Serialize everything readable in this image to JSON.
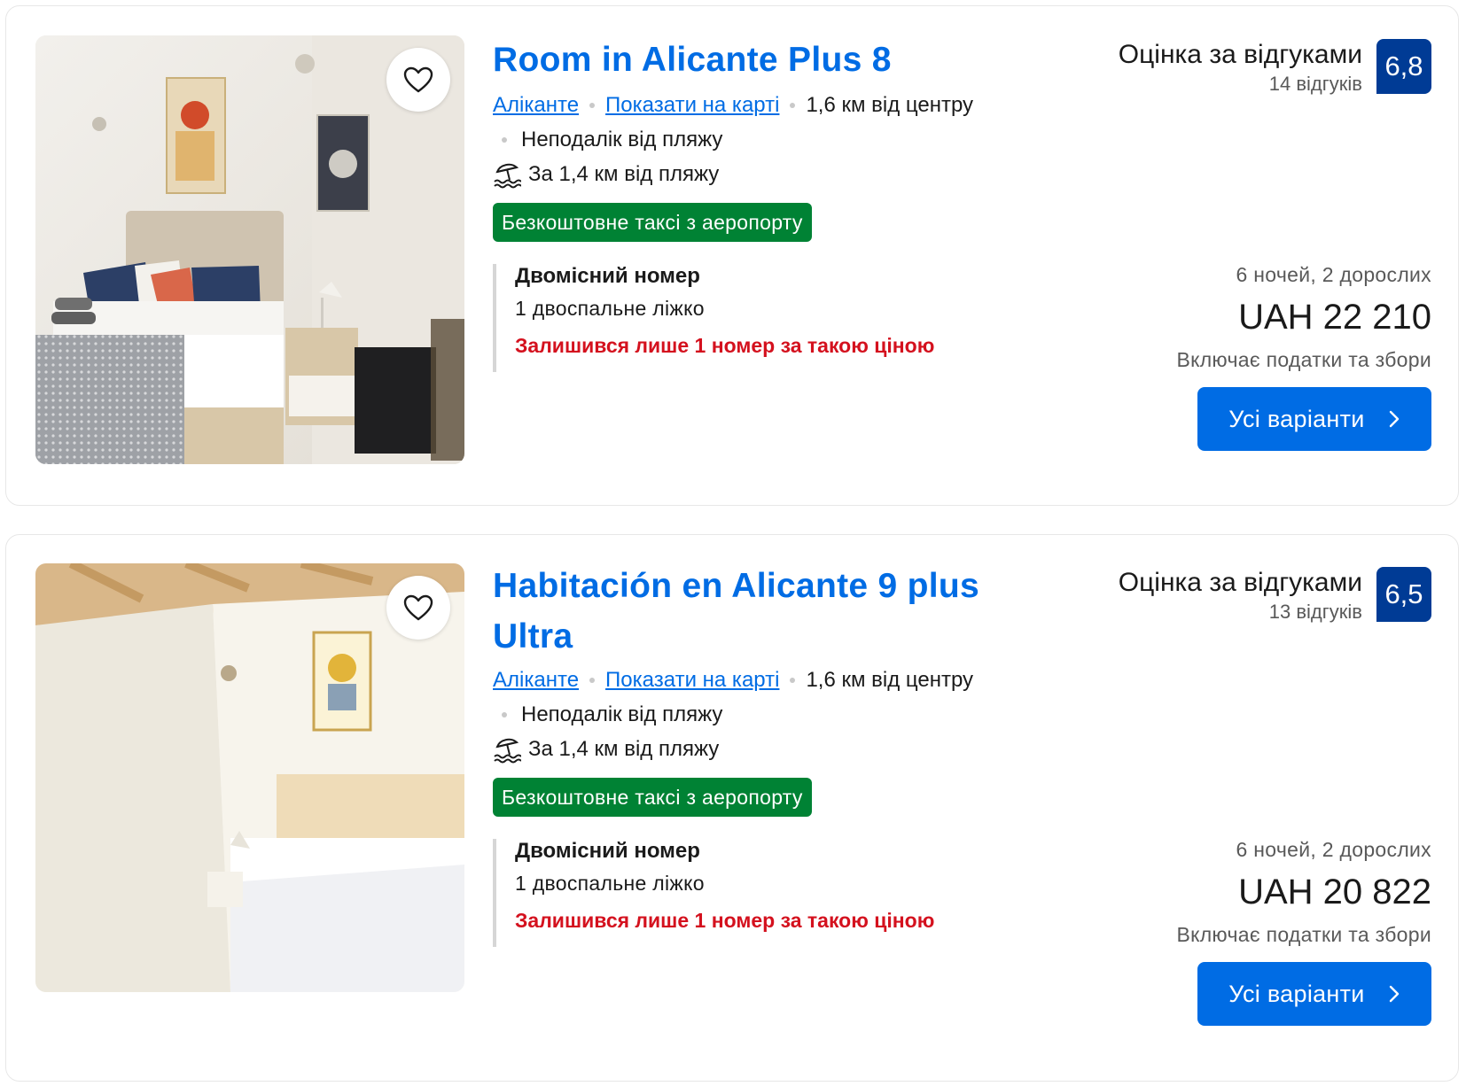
{
  "listings": [
    {
      "title": "Room in Alicante Plus 8",
      "city": "Аліканте",
      "show_on_map": "Показати на карті",
      "distance": "1,6 км від центру",
      "near_beach": "Неподалік від пляжу",
      "beach_distance": "За 1,4 км від пляжу",
      "taxi_badge": "Безкоштовне таксі з аеропорту",
      "room_name": "Двомісний номер",
      "bed": "1 двоспальне ліжко",
      "availability": "Залишився лише 1 номер за такою ціною",
      "score_label": "Оцінка за відгуками",
      "review_count": "14 відгуків",
      "score": "6,8",
      "stay": "6 ночей, 2 дорослих",
      "price": "UAH 22 210",
      "taxes_note": "Включає податки та збори",
      "cta": "Усі варіанти"
    },
    {
      "title": "Habitación en Alicante 9 plus Ultra",
      "city": "Аліканте",
      "show_on_map": "Показати на карті",
      "distance": "1,6 км від центру",
      "near_beach": "Неподалік від пляжу",
      "beach_distance": "За 1,4 км від пляжу",
      "taxi_badge": "Безкоштовне таксі з аеропорту",
      "room_name": "Двомісний номер",
      "bed": "1 двоспальне ліжко",
      "availability": "Залишився лише 1 номер за такою ціною",
      "score_label": "Оцінка за відгуками",
      "review_count": "13 відгуків",
      "score": "6,5",
      "stay": "6 ночей, 2 дорослих",
      "price": "UAH 20 822",
      "taxes_note": "Включає податки та збори",
      "cta": "Усі варіанти"
    }
  ],
  "colors": {
    "link": "#006ce4",
    "score_badge": "#003b95",
    "taxi_badge": "#008234",
    "warning": "#d4111e",
    "button": "#006ce4"
  },
  "icons": [
    "heart-icon",
    "beach-umbrella-icon",
    "chevron-right-icon"
  ]
}
